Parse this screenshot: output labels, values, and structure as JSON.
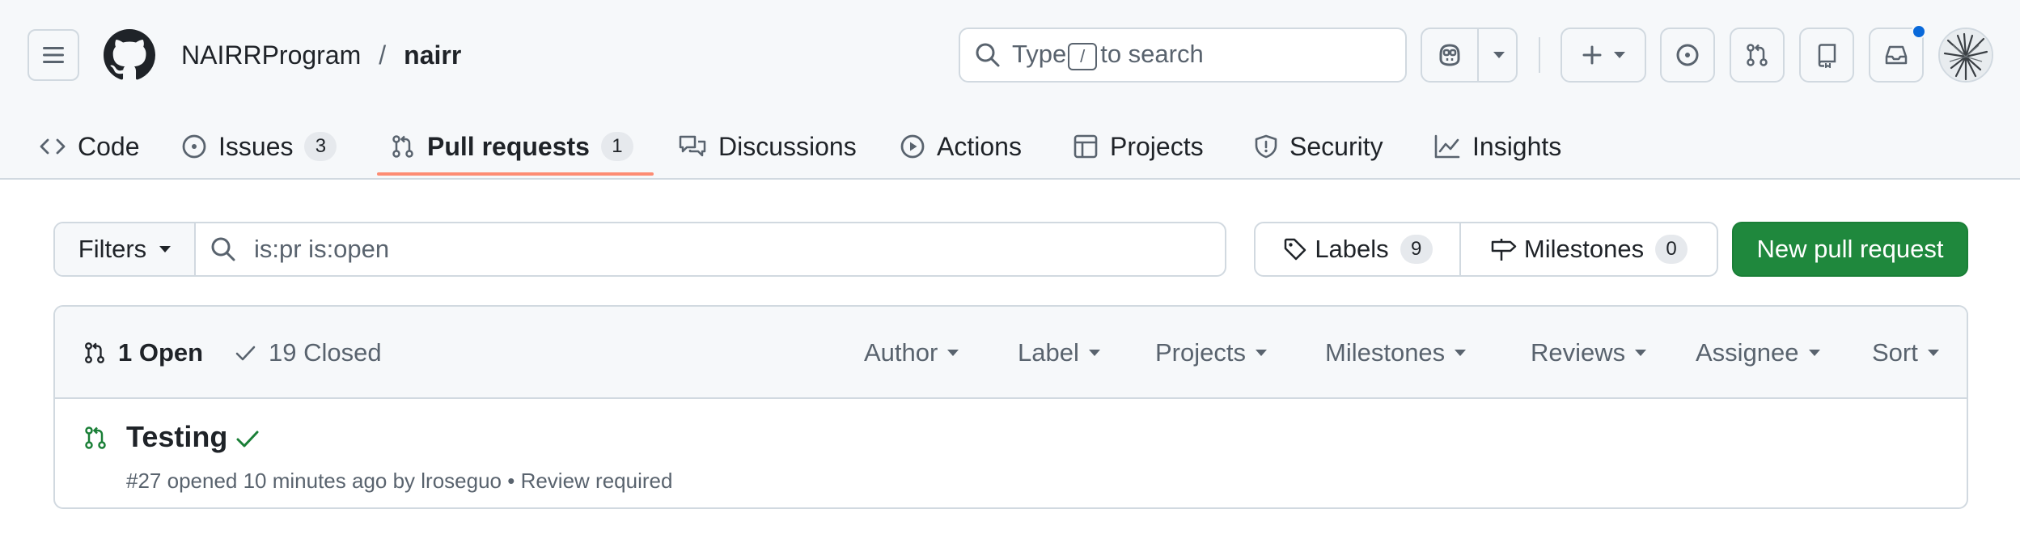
{
  "header": {
    "owner": "NAIRRProgram",
    "separator": "/",
    "repo": "nairr",
    "search": {
      "prefix": "Type",
      "key": "/",
      "suffix": "to search"
    }
  },
  "repo_nav": [
    {
      "label": "Code",
      "icon": "code-icon"
    },
    {
      "label": "Issues",
      "icon": "issue-opened-icon",
      "count": "3"
    },
    {
      "label": "Pull requests",
      "icon": "git-pull-request-icon",
      "count": "1",
      "selected": true
    },
    {
      "label": "Discussions",
      "icon": "comment-discussion-icon"
    },
    {
      "label": "Actions",
      "icon": "play-icon"
    },
    {
      "label": "Projects",
      "icon": "table-icon"
    },
    {
      "label": "Security",
      "icon": "shield-icon"
    },
    {
      "label": "Insights",
      "icon": "graph-icon"
    }
  ],
  "toolbar": {
    "filters_label": "Filters",
    "query": "is:pr is:open",
    "labels_label": "Labels",
    "labels_count": "9",
    "milestones_label": "Milestones",
    "milestones_count": "0",
    "new_pr_label": "New pull request"
  },
  "list": {
    "open_label": "1 Open",
    "closed_label": "19 Closed",
    "filters": [
      "Author",
      "Label",
      "Projects",
      "Milestones",
      "Reviews",
      "Assignee",
      "Sort"
    ],
    "items": [
      {
        "title": "Testing",
        "status": "check-passed",
        "meta": "#27 opened 10 minutes ago by lroseguo • Review required"
      }
    ]
  },
  "colors": {
    "accent_green": "#1f883d",
    "open_green": "#1a7f37",
    "selected_underline": "#fd8c73",
    "notification_blue": "#0969da"
  }
}
